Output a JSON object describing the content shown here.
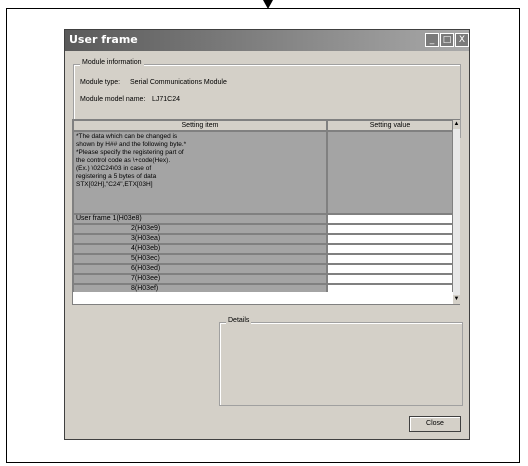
{
  "window": {
    "title": "User frame",
    "min_glyph": "_",
    "max_glyph": "□",
    "close_glyph": "X"
  },
  "module_info": {
    "group_title": "Module information",
    "type_label": "Module type:",
    "type_value": "Serial Communications Module",
    "model_label": "Module model name:",
    "model_value": "LJ71C24"
  },
  "table": {
    "col_item": "Setting item",
    "col_value": "Setting value",
    "description": "*The data which can be changed is\nshown by H## and the following byte.*\n*Please specify the registering part of\nthe control code as \\+code(Hex).\n(Ex.) \\02C24\\03 in case of\nregistering a 5 bytes of data\nSTX[02H],\"C24\",ETX[03H]",
    "rows": [
      "User frame 1(H03e8)",
      "2(H03e9)",
      "3(H03ea)",
      "4(H03eb)",
      "5(H03ec)",
      "6(H03ed)",
      "7(H03ee)",
      "8(H03ef)"
    ]
  },
  "details": {
    "group_title": "Details"
  },
  "close_button": "Close"
}
